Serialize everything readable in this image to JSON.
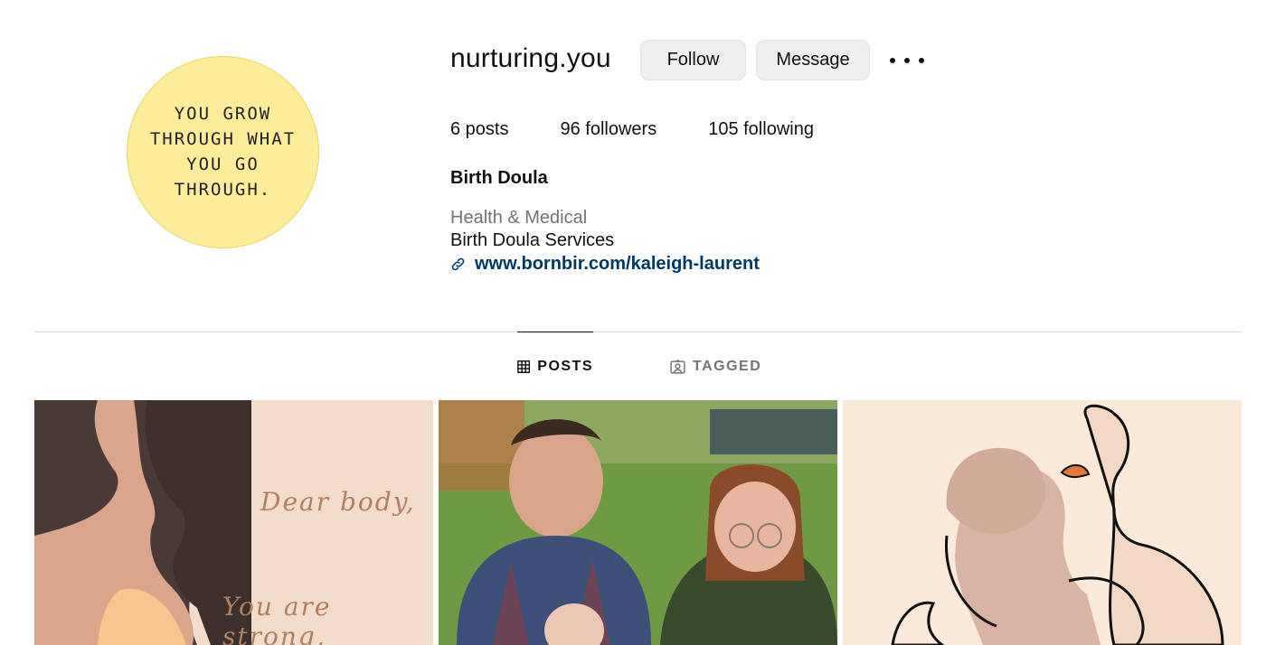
{
  "profile": {
    "avatar_quote": "YOU GROW\nTHROUGH WHAT\nYOU GO\nTHROUGH.",
    "username": "nurturing.you",
    "follow_label": "Follow",
    "message_label": "Message",
    "more_icon": "more-horizontal-icon"
  },
  "stats": {
    "posts": "6 posts",
    "followers": "96 followers",
    "following": "105 following"
  },
  "bio": {
    "name": "Birth Doula",
    "category": "Health & Medical",
    "description": "Birth Doula Services",
    "link": "www.bornbir.com/kaleigh-laurent",
    "link_icon": "link-icon"
  },
  "tabs": {
    "posts_label": "POSTS",
    "tagged_label": "TAGGED",
    "active": "POSTS"
  },
  "posts": [
    {
      "line1": "Dear body,",
      "line2": "You are strong,"
    },
    {
      "kind": "photo"
    },
    {
      "kind": "illustration"
    }
  ],
  "colors": {
    "avatar_bg": "#fdec9a",
    "link": "#00376b",
    "button_bg": "#efefef",
    "muted": "#737373"
  }
}
